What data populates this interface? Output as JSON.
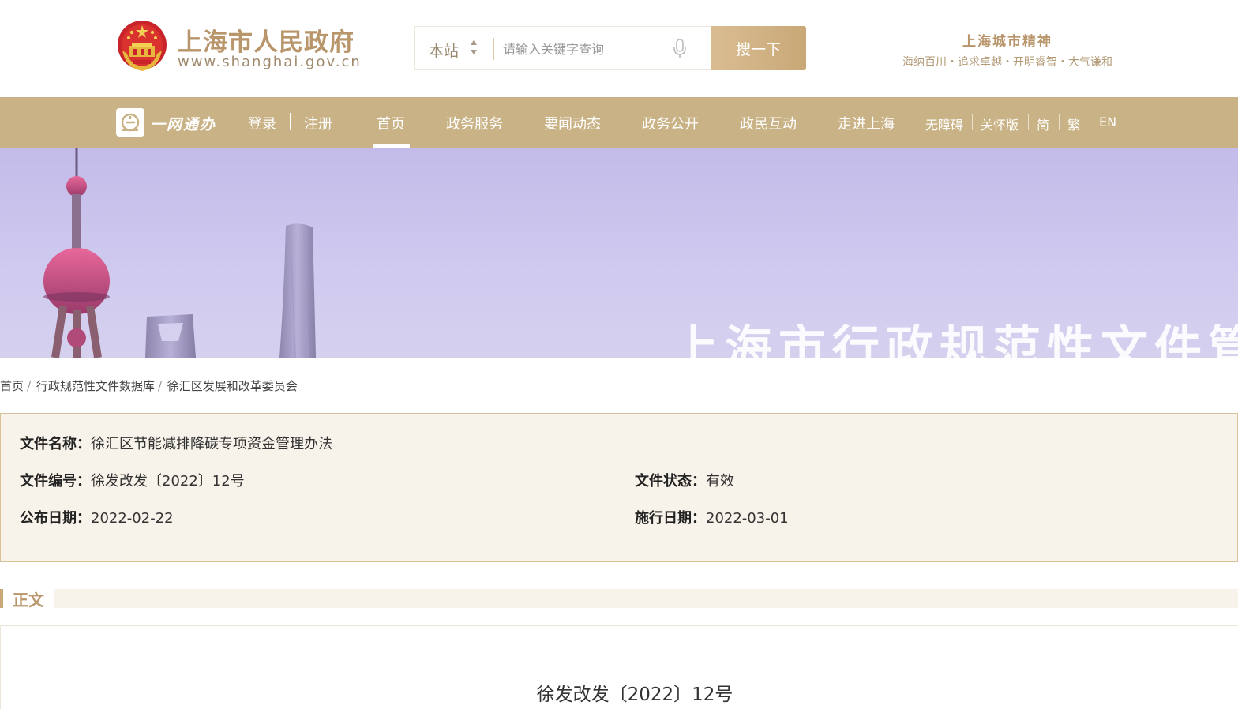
{
  "header": {
    "title": "上海市人民政府",
    "url": "www.shanghai.gov.cn",
    "search": {
      "scope": "本站",
      "placeholder": "请输入关键字查询",
      "button": "搜一下"
    },
    "spirit": {
      "title": "上海城市精神",
      "subtitle": "海纳百川・追求卓越・开明睿智・大气谦和"
    }
  },
  "nav": {
    "ywtb": "一网通办",
    "login": "登录",
    "register": "注册",
    "items": [
      {
        "label": "首页",
        "active": true
      },
      {
        "label": "政务服务"
      },
      {
        "label": "要闻动态"
      },
      {
        "label": "政务公开"
      },
      {
        "label": "政民互动"
      },
      {
        "label": "走进上海"
      }
    ],
    "tools": [
      "无障碍",
      "关怀版",
      "简",
      "繁",
      "EN"
    ]
  },
  "banner": {
    "text": "上海市行政规范性文件管理"
  },
  "breadcrumb": [
    "首页",
    "行政规范性文件数据库",
    "徐汇区发展和改革委员会"
  ],
  "info": {
    "name_label": "文件名称：",
    "name": "徐汇区节能减排降碳专项资金管理办法",
    "number_label": "文件编号：",
    "number": "徐发改发〔2022〕12号",
    "status_label": "文件状态：",
    "status": "有效",
    "publish_label": "公布日期：",
    "publish_date": "2022-02-22",
    "effective_label": "施行日期：",
    "effective_date": "2022-03-01"
  },
  "section": {
    "title": "正文"
  },
  "content": {
    "doc_number": "徐发改发〔2022〕12号"
  },
  "colors": {
    "gold": "#c9b285",
    "gold_text": "#b8956a",
    "info_bg": "#f8f3ea"
  }
}
